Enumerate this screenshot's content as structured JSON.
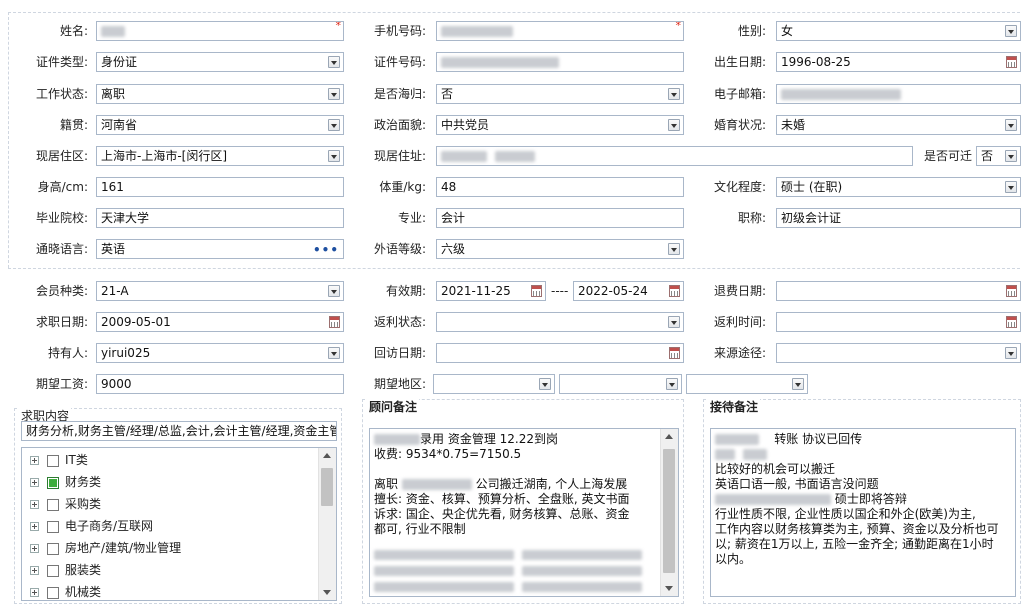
{
  "section1": {
    "name_label": "姓名:",
    "phone_label": "手机号码:",
    "gender_label": "性别:",
    "gender_value": "女",
    "idtype_label": "证件类型:",
    "idtype_value": "身份证",
    "idno_label": "证件号码:",
    "birth_label": "出生日期:",
    "birth_value": "1996-08-25",
    "workstatus_label": "工作状态:",
    "workstatus_value": "离职",
    "overseas_label": "是否海归:",
    "overseas_value": "否",
    "email_label": "电子邮箱:",
    "native_label": "籍贯:",
    "native_value": "河南省",
    "political_label": "政治面貌:",
    "political_value": "中共党员",
    "marital_label": "婚育状况:",
    "marital_value": "未婚",
    "residence_label": "现居住区:",
    "residence_value": "上海市-上海市-[闵行区]",
    "address_label": "现居住址:",
    "relocate_label": "是否可迁",
    "relocate_value": "否",
    "height_label": "身高/cm:",
    "height_value": "161",
    "weight_label": "体重/kg:",
    "weight_value": "48",
    "education_label": "文化程度:",
    "education_value": "硕士 (在职)",
    "school_label": "毕业院校:",
    "school_value": "天津大学",
    "major_label": "专业:",
    "major_value": "会计",
    "title_label": "职称:",
    "title_value": "初级会计证",
    "language_label": "通晓语言:",
    "language_value": "英语",
    "langlevel_label": "外语等级:",
    "langlevel_value": "六级"
  },
  "section2": {
    "member_label": "会员种类:",
    "member_value": "21-A",
    "validity_label": "有效期:",
    "validity_start": "2021-11-25",
    "validity_sep": "----",
    "validity_end": "2022-05-24",
    "refund_label": "退费日期:",
    "jobdate_label": "求职日期:",
    "jobdate_value": "2009-05-01",
    "rebate_label": "返利状态:",
    "rebatetime_label": "返利时间:",
    "holder_label": "持有人:",
    "holder_value": "yirui025",
    "revisit_label": "回访日期:",
    "source_label": "来源途径:",
    "salary_label": "期望工资:",
    "salary_value": "9000",
    "area_label": "期望地区:"
  },
  "job": {
    "title": "求职内容",
    "summary": "财务分析,财务主管/经理/总监,会计,会计主管/经理,资金主管",
    "items": [
      {
        "label": "IT类",
        "checked": false
      },
      {
        "label": "财务类",
        "checked": true
      },
      {
        "label": "采购类",
        "checked": false
      },
      {
        "label": "电子商务/互联网",
        "checked": false
      },
      {
        "label": "房地产/建筑/物业管理",
        "checked": false
      },
      {
        "label": "服装类",
        "checked": false
      },
      {
        "label": "机械类",
        "checked": false
      }
    ]
  },
  "advisor": {
    "title": "顾问备注",
    "line1": "录用 资金管理  12.22到岗",
    "line2": "收费: 9534*0.75=7150.5",
    "line3": "离职",
    "line3b": "公司搬迁湖南, 个人上海发展",
    "line4": "擅长: 资金、核算、预算分析、全盘账, 英文书面",
    "line5": "诉求: 国企、央企优先看, 财务核算、总账、资金",
    "line6": "都可, 行业不限制"
  },
  "reception": {
    "title": "接待备注",
    "line1": "转账 协议已回传",
    "line2": "比较好的机会可以搬迁",
    "line3": "英语口语一般, 书面语言没问题",
    "line4": "硕士即将答辩",
    "line5": "行业性质不限, 企业性质以国企和外企(欧美)为主,",
    "line6": "工作内容以财务核算类为主, 预算、资金以及分析也可",
    "line7": "以; 薪资在1万以上, 五险一金齐全; 通勤距离在1小时",
    "line8": "以内。"
  }
}
